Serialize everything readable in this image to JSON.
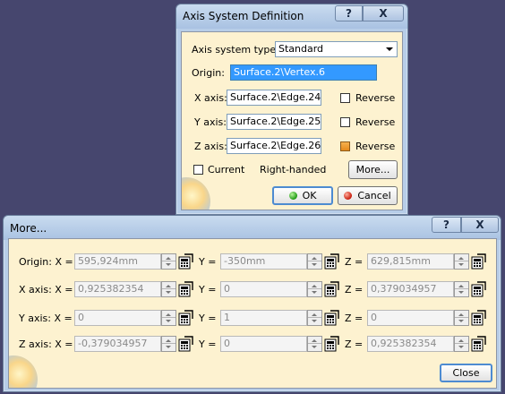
{
  "axis_dialog": {
    "title": "Axis System Definition",
    "help_label": "?",
    "close_label": "X",
    "type_label": "Axis system type:",
    "type_value": "Standard",
    "origin_label": "Origin:",
    "origin_value": "Surface.2\\Vertex.6",
    "x_axis_label": "X axis:",
    "x_axis_value": "Surface.2\\Edge.24",
    "y_axis_label": "Y axis:",
    "y_axis_value": "Surface.2\\Edge.25",
    "z_axis_label": "Z axis:",
    "z_axis_value": "Surface.2\\Edge.26",
    "reverse_label": "Reverse",
    "reverse_x_checked": false,
    "reverse_y_checked": false,
    "reverse_z_checked": true,
    "current_label": "Current",
    "current_checked": false,
    "handedness": "Right-handed",
    "more_label": "More...",
    "ok_label": "OK",
    "cancel_label": "Cancel"
  },
  "more_dialog": {
    "title": "More...",
    "help_label": "?",
    "close_label": "X",
    "rows": [
      {
        "label": "Origin: X =",
        "x": "595,924mm",
        "y": "-350mm",
        "z": "629,815mm"
      },
      {
        "label": "X axis: X =",
        "x": "0,925382354",
        "y": "0",
        "z": "0,379034957"
      },
      {
        "label": "Y axis: X =",
        "x": "0",
        "y": "1",
        "z": "0"
      },
      {
        "label": "Z axis: X =",
        "x": "-0,379034957",
        "y": "0",
        "z": "0,925382354"
      }
    ],
    "y_label": "Y =",
    "z_label": "Z =",
    "close_button_label": "Close"
  },
  "colors": {
    "desktop": "#46466e",
    "frame": "#b7cde8",
    "panel": "#fdf2d0",
    "selection": "#3399ff",
    "default_button_ring": "#4d8bd1"
  },
  "icons": {
    "spinner": "spinner-icon",
    "formula": "formula-calculator-icon",
    "ok": "green-dot-icon",
    "cancel": "red-dot-icon"
  }
}
